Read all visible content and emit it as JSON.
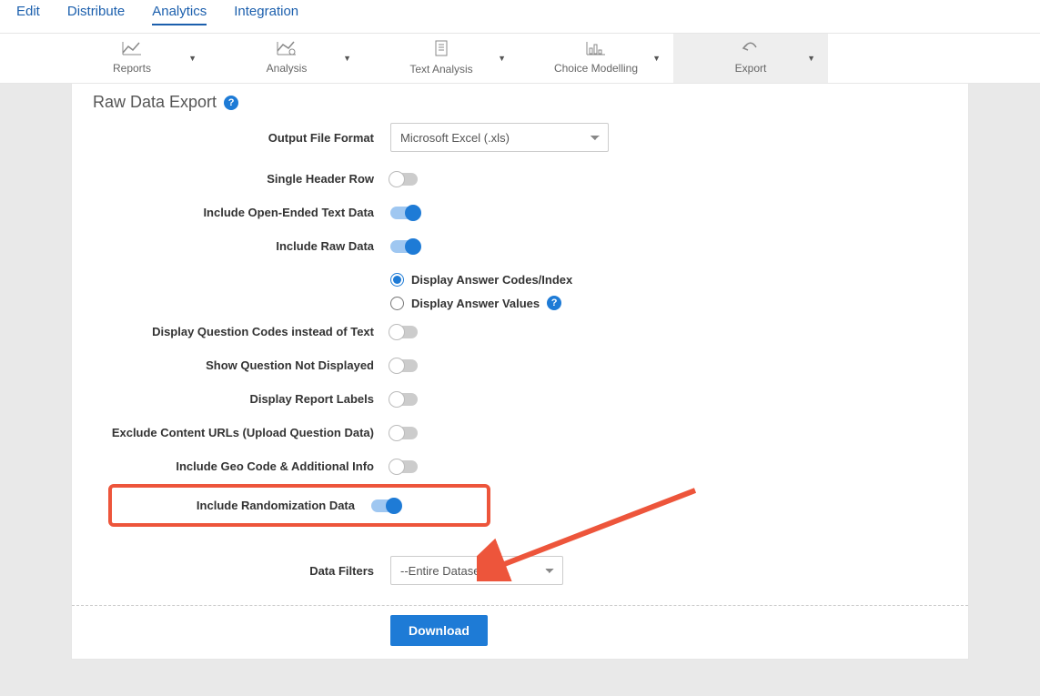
{
  "topnav": {
    "edit": "Edit",
    "distribute": "Distribute",
    "analytics": "Analytics",
    "integration": "Integration"
  },
  "toolbar": {
    "reports": "Reports",
    "analysis": "Analysis",
    "text_analysis": "Text Analysis",
    "choice_modelling": "Choice Modelling",
    "export": "Export"
  },
  "page": {
    "title": "Raw Data Export"
  },
  "form": {
    "output_format_label": "Output File Format",
    "output_format_value": "Microsoft Excel (.xls)",
    "single_header_label": "Single Header Row",
    "single_header_on": false,
    "open_ended_label": "Include Open-Ended Text Data",
    "open_ended_on": true,
    "raw_data_label": "Include Raw Data",
    "raw_data_on": true,
    "radio_codes": "Display Answer Codes/Index",
    "radio_values": "Display Answer Values",
    "radio_selected": "codes",
    "question_codes_label": "Display Question Codes instead of Text",
    "question_codes_on": false,
    "show_not_displayed_label": "Show Question Not Displayed",
    "show_not_displayed_on": false,
    "report_labels_label": "Display Report Labels",
    "report_labels_on": false,
    "exclude_urls_label": "Exclude Content URLs (Upload Question Data)",
    "exclude_urls_on": false,
    "geo_code_label": "Include Geo Code & Additional Info",
    "geo_code_on": false,
    "randomization_label": "Include Randomization Data",
    "randomization_on": true,
    "data_filters_label": "Data Filters",
    "data_filters_value": "--Entire Dataset--",
    "download": "Download"
  }
}
